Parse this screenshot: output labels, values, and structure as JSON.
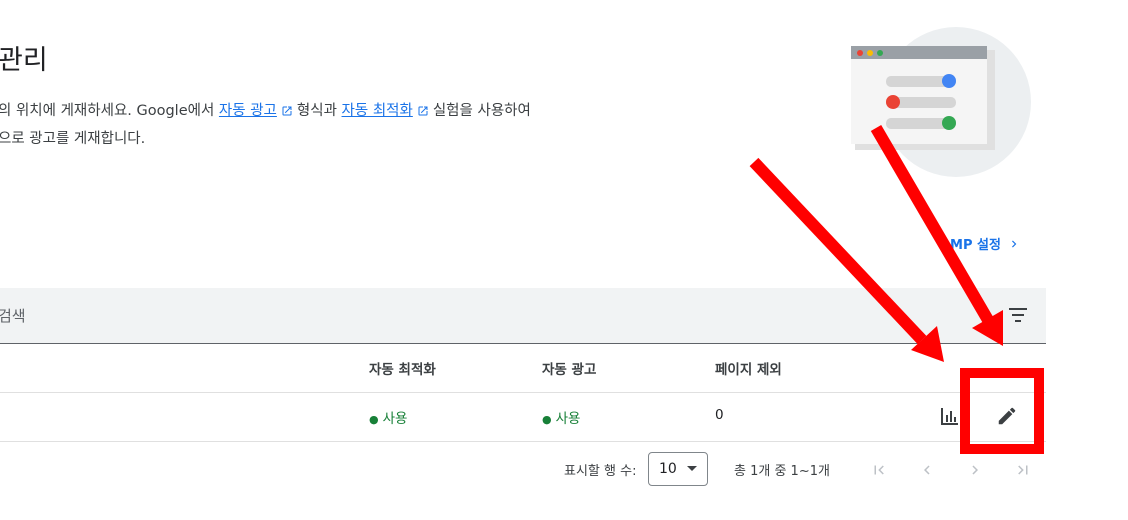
{
  "page": {
    "title": "관리",
    "description": {
      "part1": "의 위치에 게재하세요. Google에서 ",
      "link1": "자동 광고",
      "part2": "형식과 ",
      "link2": "자동 최적화",
      "part3": "실험을 사용하여",
      "line2": "으로 광고를 게재합니다."
    },
    "amp_link": "AMP 설정"
  },
  "search": {
    "placeholder": "검색"
  },
  "table": {
    "columns": [
      "자동 최적화",
      "자동 광고",
      "페이지 제외"
    ],
    "rows": [
      {
        "auto_optimize": "사용",
        "auto_ads": "사용",
        "page_exclusions": "0"
      }
    ]
  },
  "pagination": {
    "rows_label": "표시할 행 수:",
    "rows_value": "10",
    "range": "총 1개 중 1~1개"
  },
  "colors": {
    "accent": "#1a73e8",
    "status_on": "#188038",
    "annotation": "#ff0000"
  },
  "icons": [
    "external-link-icon",
    "chevron-right-icon",
    "filter-icon",
    "bar-chart-icon",
    "pencil-icon",
    "first-page-icon",
    "prev-page-icon",
    "next-page-icon",
    "last-page-icon"
  ]
}
